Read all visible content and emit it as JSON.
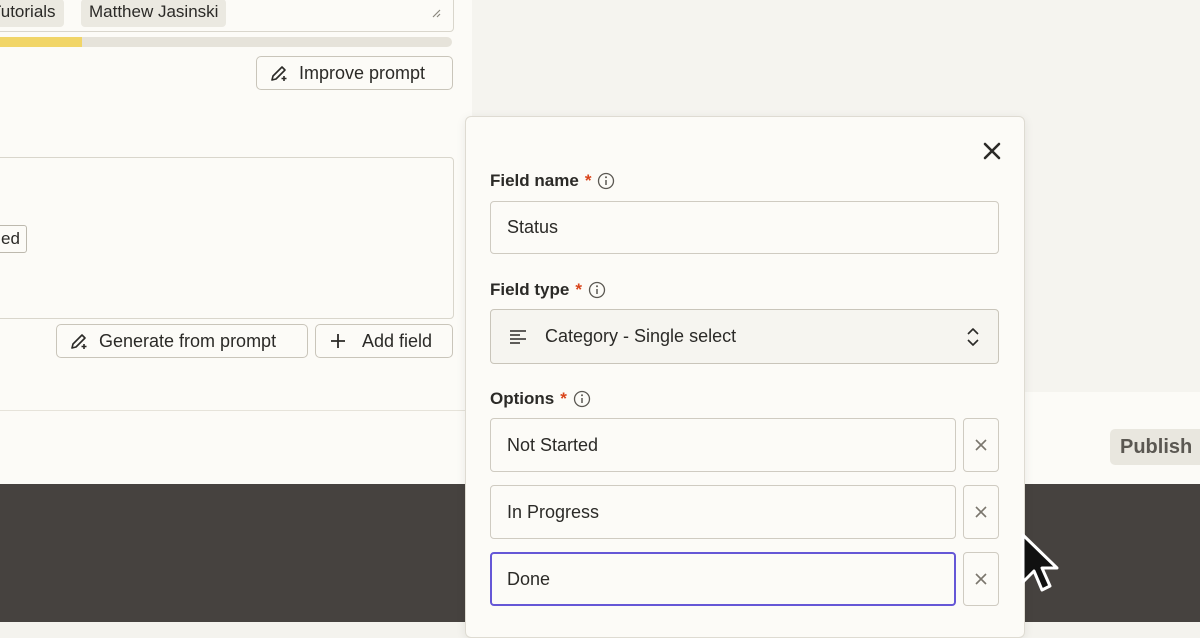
{
  "prompt_panel": {
    "tags": [
      "Tutorials",
      "Matthew Jasinski"
    ],
    "progress_fraction": 0.2,
    "improve_label": "Improve prompt"
  },
  "fields_panel": {
    "partial_tag": "ed",
    "generate_label": "Generate from prompt",
    "add_field_label": "Add field"
  },
  "footer": {
    "publish_label": "Publish"
  },
  "modal": {
    "field_name_label": "Field name",
    "field_name_value": "Status",
    "field_type_label": "Field type",
    "field_type_value": "Category - Single select",
    "options_label": "Options",
    "options": [
      "Not Started",
      "In Progress",
      "Done"
    ],
    "required_mark": "*"
  },
  "colors": {
    "accent": "#6557d6",
    "required": "#d9441a",
    "progress": "#f1d567"
  },
  "icons": [
    "close-icon",
    "info-icon",
    "pencil-sparkle-icon",
    "plus-icon",
    "align-left-icon",
    "chevron-updown-icon",
    "x-icon",
    "cursor-arrow-icon"
  ]
}
